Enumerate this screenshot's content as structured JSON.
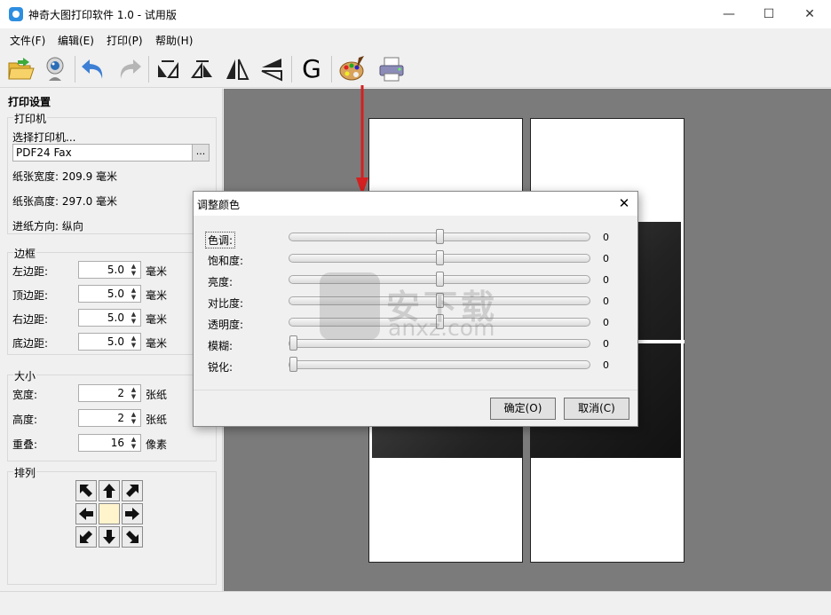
{
  "window": {
    "title": "神奇大图打印软件 1.0 - 试用版",
    "minimize_glyph": "—",
    "maximize_glyph": "☐",
    "close_glyph": "✕"
  },
  "menu": [
    {
      "label": "文件(F)"
    },
    {
      "label": "编辑(E)"
    },
    {
      "label": "打印(P)"
    },
    {
      "label": "帮助(H)"
    }
  ],
  "toolbar": {
    "icons": [
      "open-folder-icon",
      "webcam-icon",
      "undo-icon",
      "redo-icon",
      "flip-up-icon",
      "flip-down-icon",
      "mirror-horizontal-icon",
      "mirror-vertical-icon",
      "grayscale-icon",
      "palette-icon",
      "printer-icon"
    ],
    "grayscale_glyph": "G"
  },
  "panel": {
    "title": "打印设置",
    "printer": {
      "group_title": "打印机",
      "select_label": "选择打印机...",
      "selected_printer": "PDF24 Fax",
      "browse_label": "...",
      "paper_width": "纸张宽度: 209.9 毫米",
      "paper_height": "纸张高度: 297.0 毫米",
      "feed_direction": "进纸方向: 纵向"
    },
    "margins": {
      "group_title": "边框",
      "rows": [
        {
          "label": "左边距:",
          "value": "5.0",
          "unit": "毫米"
        },
        {
          "label": "顶边距:",
          "value": "5.0",
          "unit": "毫米"
        },
        {
          "label": "右边距:",
          "value": "5.0",
          "unit": "毫米"
        },
        {
          "label": "底边距:",
          "value": "5.0",
          "unit": "毫米"
        }
      ]
    },
    "size": {
      "group_title": "大小",
      "rows": [
        {
          "label": "宽度:",
          "value": "2",
          "unit": "张纸"
        },
        {
          "label": "高度:",
          "value": "2",
          "unit": "张纸"
        },
        {
          "label": "重叠:",
          "value": "16",
          "unit": "像素"
        }
      ]
    },
    "arrange": {
      "group_title": "排列"
    }
  },
  "dialog": {
    "title": "调整颜色",
    "close_glyph": "✕",
    "sliders": [
      {
        "label": "色调:",
        "value": "0",
        "level": 0.5
      },
      {
        "label": "饱和度:",
        "value": "0",
        "level": 0.5
      },
      {
        "label": "亮度:",
        "value": "0",
        "level": 0.5
      },
      {
        "label": "对比度:",
        "value": "0",
        "level": 0.5
      },
      {
        "label": "透明度:",
        "value": "0",
        "level": 0.5
      },
      {
        "label": "模糊:",
        "value": "0",
        "level": 0.0
      },
      {
        "label": "锐化:",
        "value": "0",
        "level": 0.0
      }
    ],
    "ok_label": "确定(O)",
    "cancel_label": "取消(C)"
  },
  "watermark": {
    "text_cn": "安下载",
    "text_en": "anxz.com"
  },
  "colors": {
    "canvas_bg": "#7b7b7b",
    "annotation_arrow": "#d42020",
    "arrange_center": "#fff4cc"
  }
}
